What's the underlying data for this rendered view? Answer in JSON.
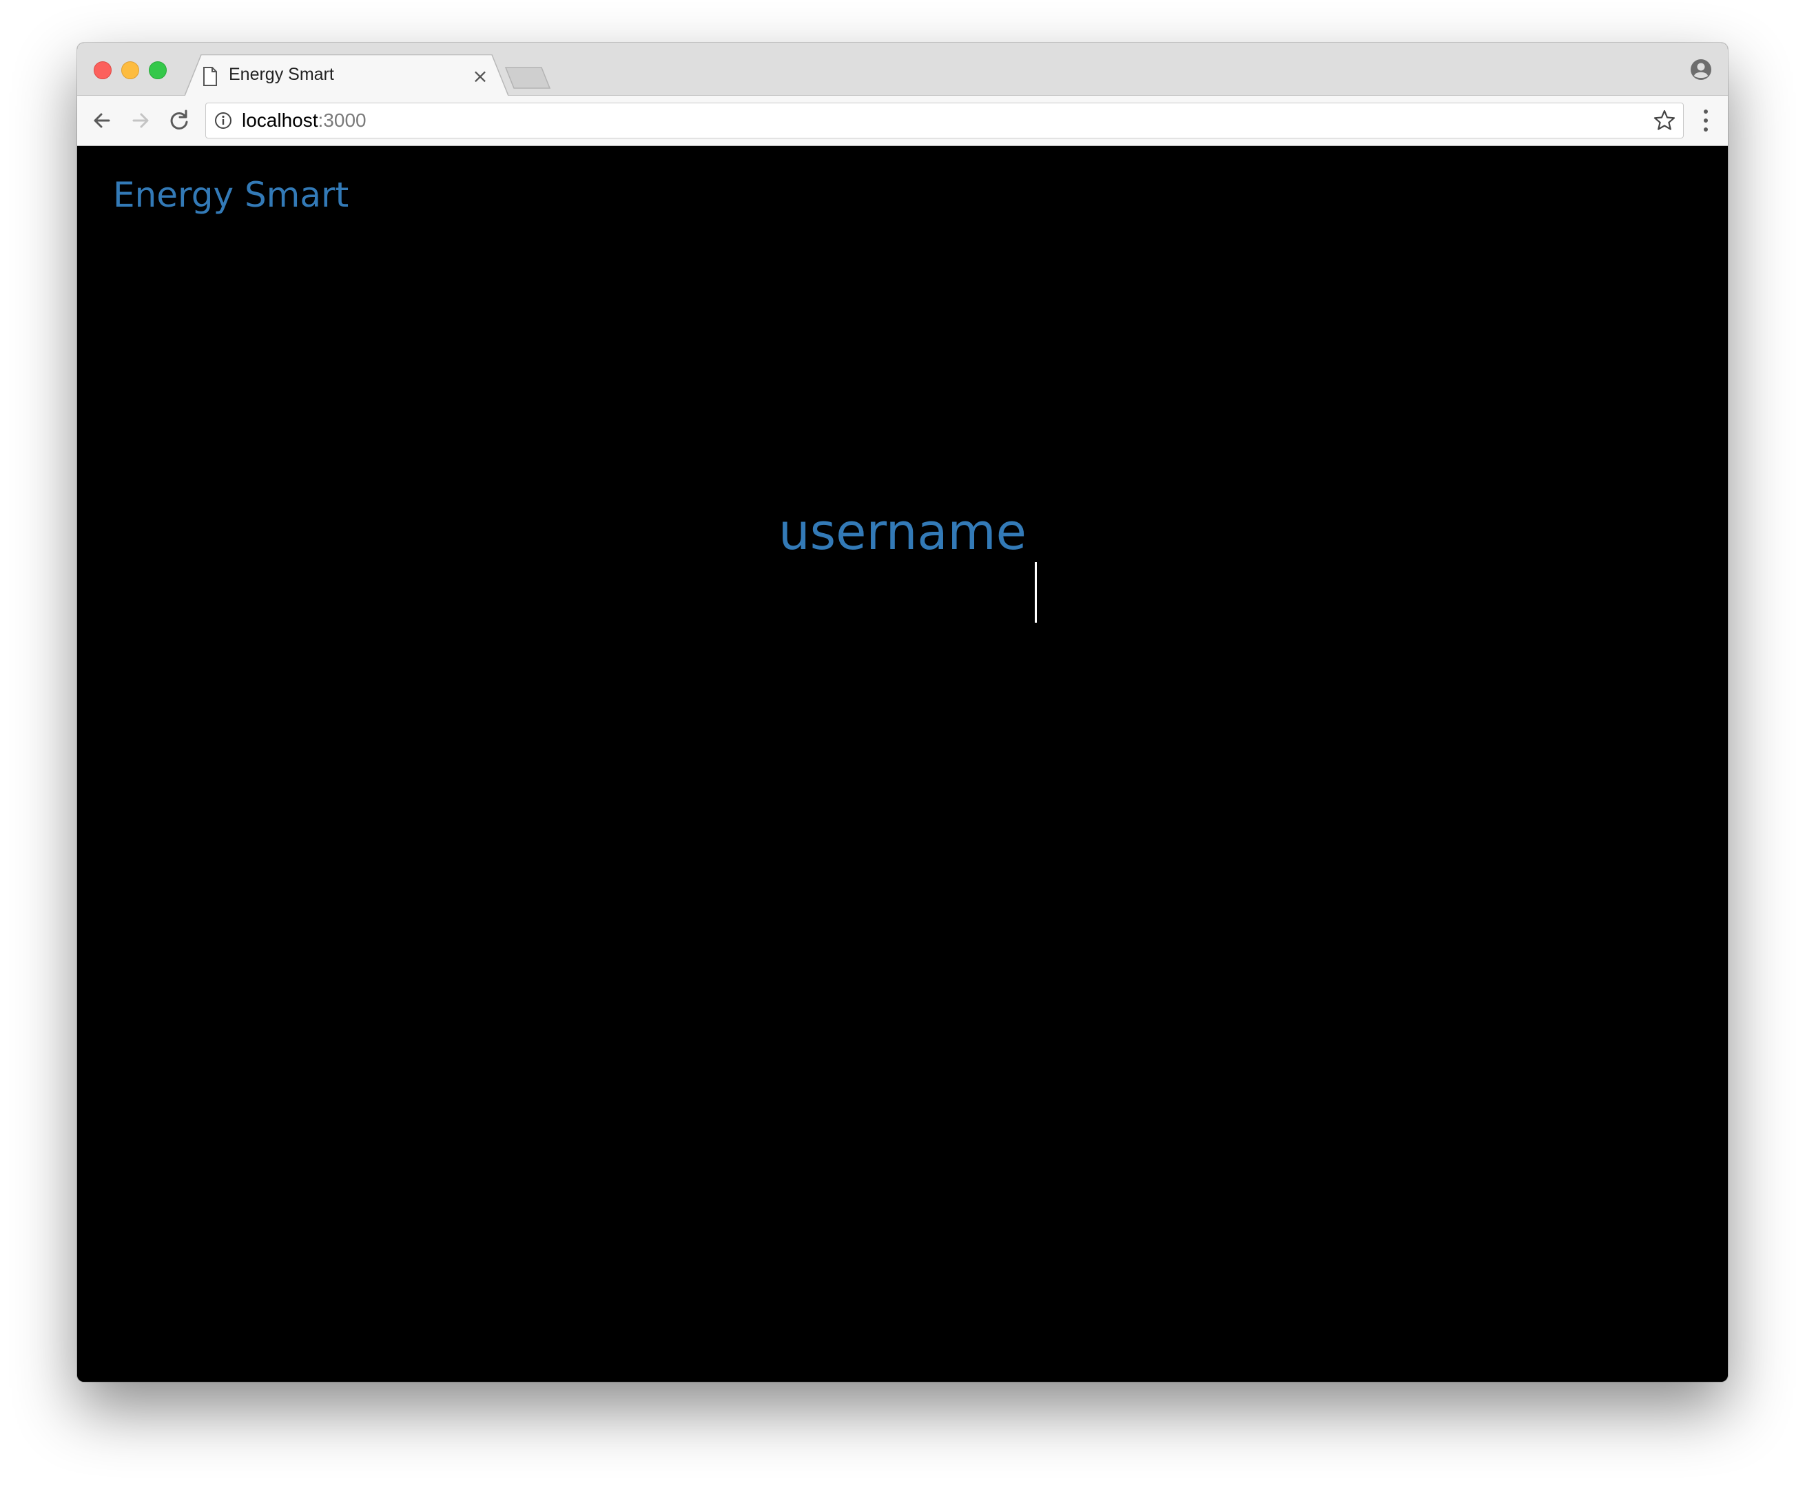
{
  "browser": {
    "tab_title": "Energy Smart",
    "tab_close_glyph": "×",
    "url_host": "localhost",
    "url_port": ":3000",
    "icons": {
      "tab": "document-icon",
      "close": "close-icon",
      "back": "back-arrow-icon",
      "forward": "forward-arrow-icon",
      "reload": "reload-icon",
      "info": "info-icon",
      "bookmark": "star-icon",
      "menu": "kebab-menu-icon",
      "profile": "profile-icon"
    }
  },
  "page": {
    "brand": "Energy Smart",
    "username_placeholder": "username",
    "username_value": ""
  },
  "colors": {
    "accent": "#337ab7",
    "background": "#000000",
    "traffic_close": "#fc605c",
    "traffic_minimize": "#fdbc40",
    "traffic_maximize": "#34c84a"
  }
}
